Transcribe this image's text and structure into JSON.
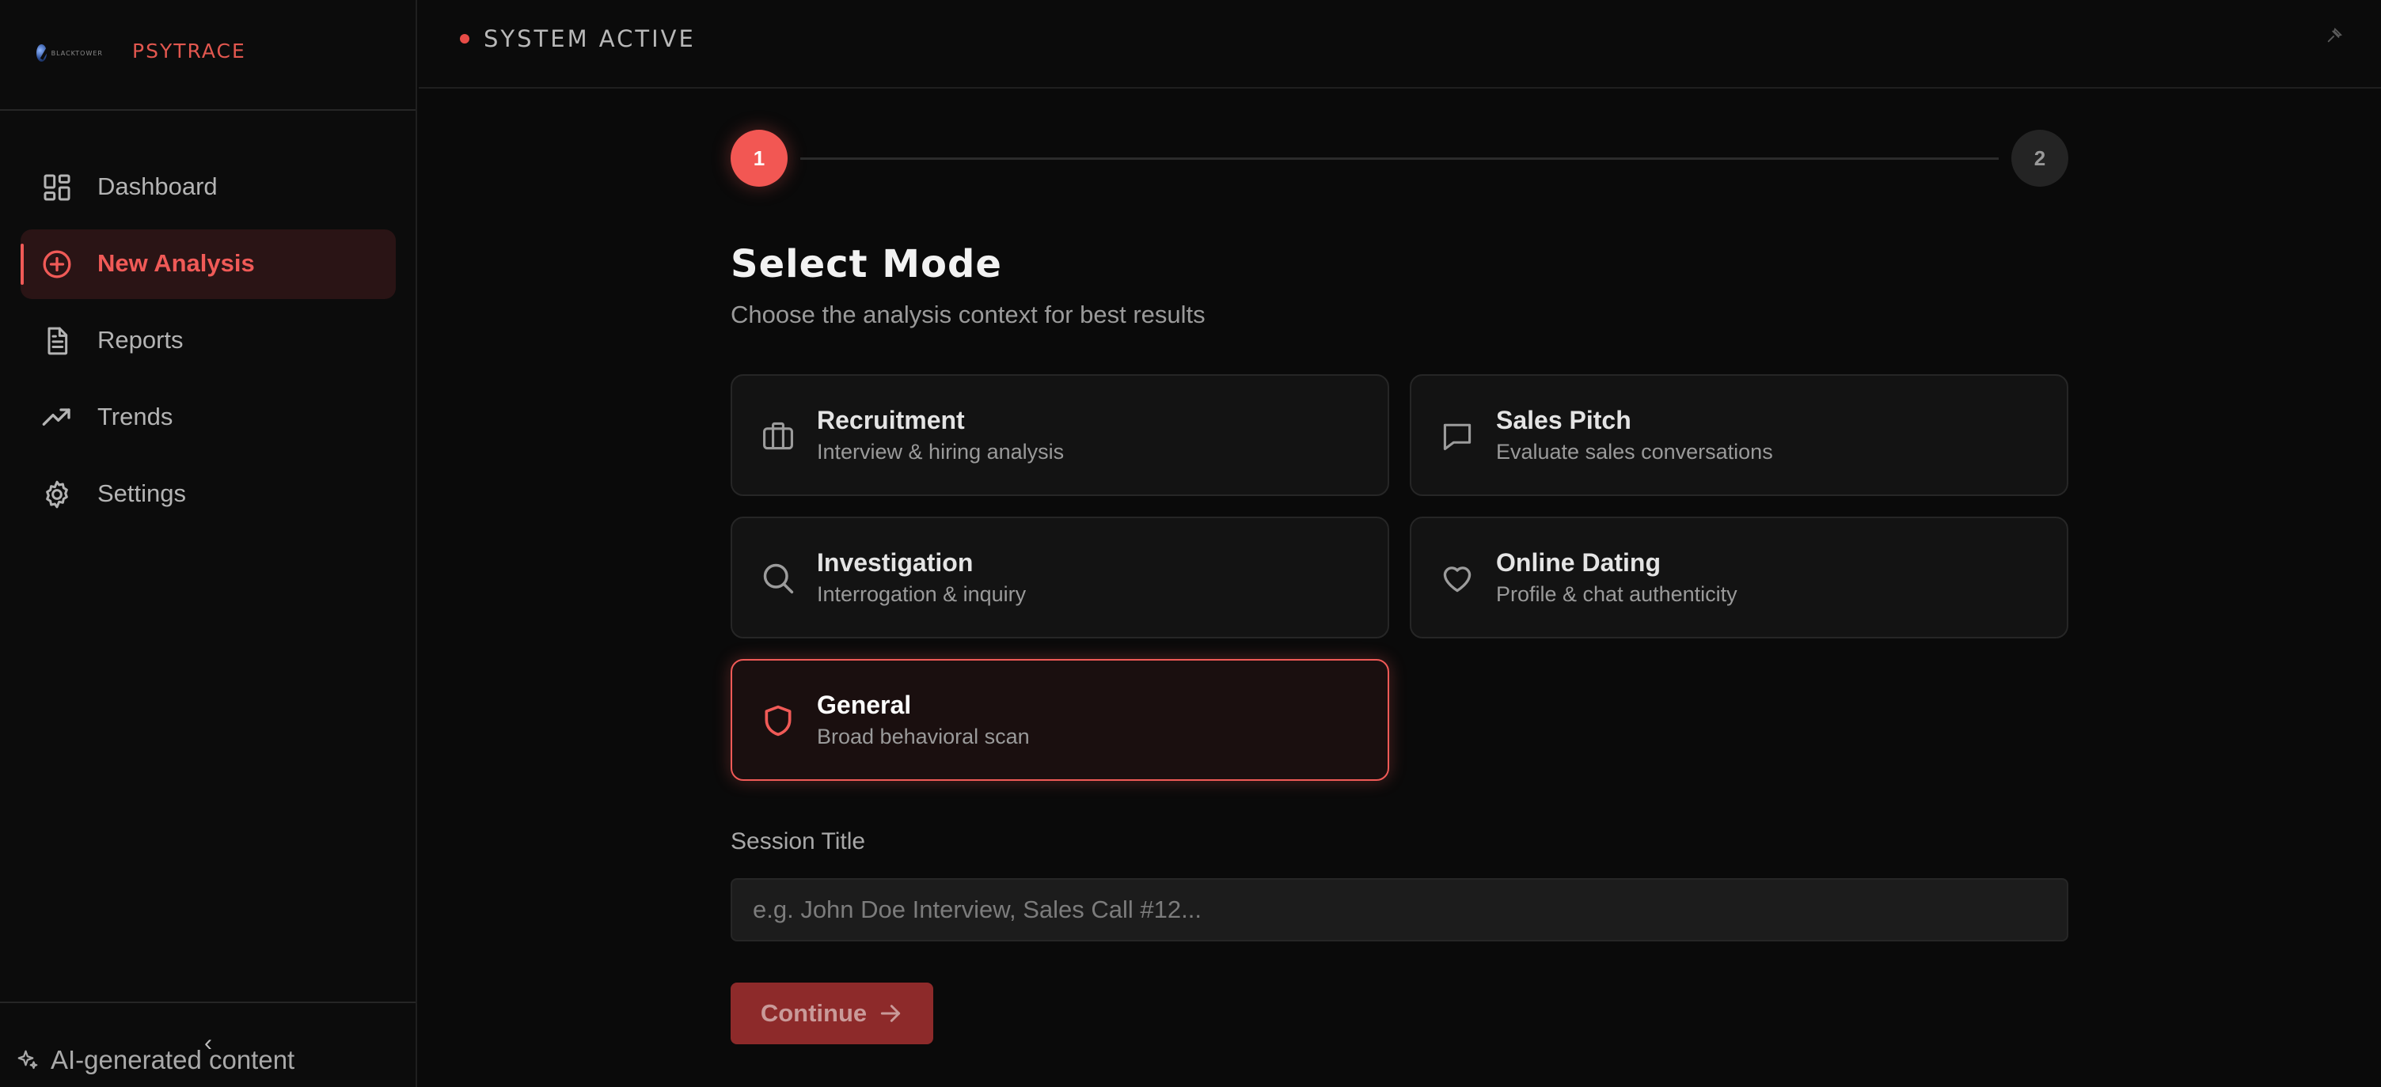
{
  "brand": {
    "logo_text": "BLACKTOWER",
    "name": "PSYTRACE"
  },
  "nav": [
    {
      "label": "Dashboard",
      "icon": "dashboard-icon",
      "active": false
    },
    {
      "label": "New Analysis",
      "icon": "plus-circle-icon",
      "active": true
    },
    {
      "label": "Reports",
      "icon": "document-icon",
      "active": false
    },
    {
      "label": "Trends",
      "icon": "trending-up-icon",
      "active": false
    },
    {
      "label": "Settings",
      "icon": "gear-icon",
      "active": false
    }
  ],
  "sidebar_footer": {
    "collapse_glyph": "‹",
    "ai_note": "AI-generated content"
  },
  "topbar": {
    "status": "SYSTEM ACTIVE",
    "status_color": "#e84c47"
  },
  "stepper": {
    "step1": "1",
    "step2": "2",
    "current": 1
  },
  "main": {
    "title": "Select Mode",
    "subtitle": "Choose the analysis context for best results",
    "modes": [
      {
        "title": "Recruitment",
        "desc": "Interview & hiring analysis",
        "icon": "briefcase-icon",
        "selected": false
      },
      {
        "title": "Sales Pitch",
        "desc": "Evaluate sales conversations",
        "icon": "chat-bubble-icon",
        "selected": false
      },
      {
        "title": "Investigation",
        "desc": "Interrogation & inquiry",
        "icon": "search-icon",
        "selected": false
      },
      {
        "title": "Online Dating",
        "desc": "Profile & chat authenticity",
        "icon": "heart-icon",
        "selected": false
      },
      {
        "title": "General",
        "desc": "Broad behavioral scan",
        "icon": "shield-icon",
        "selected": true
      }
    ],
    "session_label": "Session Title",
    "session_placeholder": "e.g. John Doe Interview, Sales Call #12...",
    "session_value": "",
    "continue_label": "Continue"
  },
  "colors": {
    "accent": "#f05a57",
    "background": "#0a0a0a",
    "card": "#131313"
  }
}
